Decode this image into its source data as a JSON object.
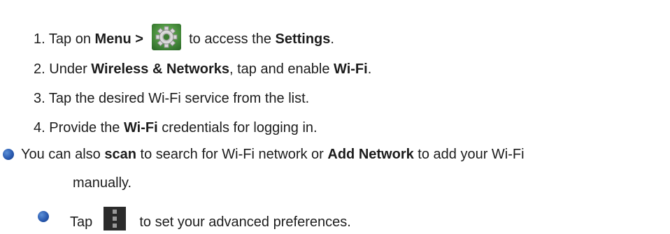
{
  "steps": [
    {
      "num": "1.",
      "t1": "Tap on",
      "b1": "Menu >",
      "t2": "to access the",
      "b2": "Settings",
      "t3": "."
    },
    {
      "num": "2.",
      "t1": "Under",
      "b1": "Wireless & Networks",
      "t2": ", tap and enable",
      "b2": "Wi-Fi",
      "t3": "."
    },
    {
      "num": "3.",
      "t1": "Tap the desired Wi-Fi service from the list."
    },
    {
      "num": "4.",
      "t1": "Provide the",
      "b1": "Wi-Fi",
      "t2": "credentials for logging in."
    }
  ],
  "note": {
    "t1": "You can also",
    "b1": "scan",
    "t2": "to search for Wi-Fi network or",
    "b2": "Add Network",
    "t3": "to add your Wi-Fi",
    "t4": "manually."
  },
  "tip": {
    "t1": "Tap",
    "t2": "to set your advanced preferences."
  },
  "icons": {
    "settings": "gear-icon",
    "menu": "overflow-menu-icon",
    "bullet": "bullet-icon"
  },
  "colors": {
    "text": "#1c1c1c",
    "bullet": "#2a5ab0",
    "gear_bg": "#3f8a3a"
  }
}
